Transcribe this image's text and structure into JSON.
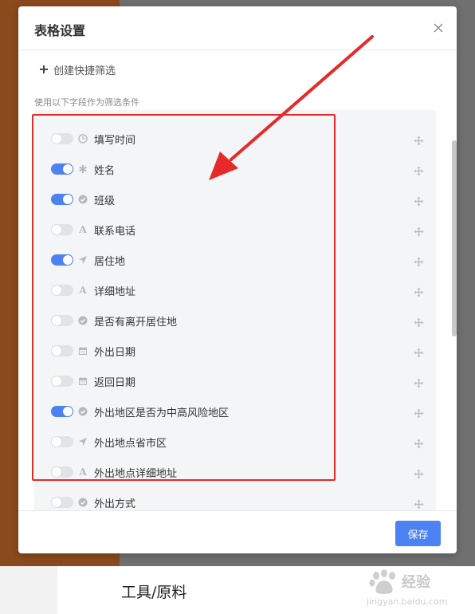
{
  "modal": {
    "title": "表格设置",
    "create_filter_label": "创建快捷筛选",
    "section_label": "使用以下字段作为筛选条件",
    "save_label": "保存"
  },
  "fields": [
    {
      "label": "填写时间",
      "enabled": false,
      "icon": "clock-icon"
    },
    {
      "label": "姓名",
      "enabled": true,
      "icon": "asterisk-icon"
    },
    {
      "label": "班级",
      "enabled": true,
      "icon": "check-circle-icon"
    },
    {
      "label": "联系电话",
      "enabled": false,
      "icon": "text-icon"
    },
    {
      "label": "居住地",
      "enabled": true,
      "icon": "location-arrow-icon"
    },
    {
      "label": "详细地址",
      "enabled": false,
      "icon": "text-icon"
    },
    {
      "label": "是否有离开居住地",
      "enabled": false,
      "icon": "check-circle-icon"
    },
    {
      "label": "外出日期",
      "enabled": false,
      "icon": "calendar-icon"
    },
    {
      "label": "返回日期",
      "enabled": false,
      "icon": "calendar-icon"
    },
    {
      "label": "外出地区是否为中高风险地区",
      "enabled": true,
      "icon": "check-circle-icon"
    },
    {
      "label": "外出地点省市区",
      "enabled": false,
      "icon": "location-arrow-icon"
    },
    {
      "label": "外出地点详细地址",
      "enabled": false,
      "icon": "text-icon"
    },
    {
      "label": "外出方式",
      "enabled": false,
      "icon": "check-circle-icon"
    }
  ],
  "background_page": {
    "title": "工具/原料"
  },
  "watermark": {
    "brand": "经验",
    "url": "jingyan.baidu.com"
  },
  "colors": {
    "accent": "#4d82f2",
    "annotation_red": "#e62a2a",
    "panel_bg": "#f4f5f7"
  }
}
